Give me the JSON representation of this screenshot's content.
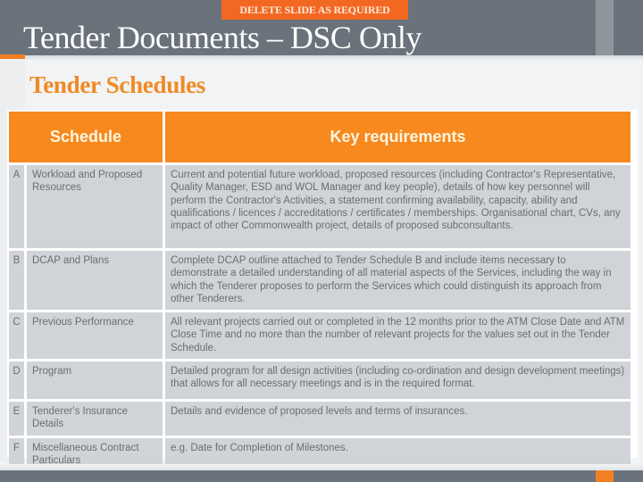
{
  "banner": {
    "label": "DELETE SLIDE AS REQUIRED"
  },
  "header": {
    "title": "Tender Documents – DSC Only"
  },
  "subtitle": "Tender Schedules",
  "colors": {
    "header_bg": "#6a737b",
    "accent_orange": "#f7891f",
    "banner_orange": "#f26722",
    "row_bg": "#d0d4d8",
    "subtitle": "#f08a24"
  },
  "table": {
    "headers": {
      "schedule": "Schedule",
      "requirements": "Key requirements"
    },
    "rows": [
      {
        "letter": "A",
        "schedule": "Workload and Proposed Resources",
        "requirements": "Current and potential future workload, proposed resources (including Contractor's Representative, Quality Manager, ESD and WOL Manager and key people), details of how key personnel will perform the Contractor's Activities, a statement confirming availability, capacity, ability and qualifications / licences / accreditations / certificates / memberships. Organisational chart, CVs, any impact of other Commonwealth project, details of proposed subconsultants."
      },
      {
        "letter": "B",
        "schedule": "DCAP and Plans",
        "requirements": "Complete DCAP outline attached to Tender Schedule B and include items necessary to demonstrate a detailed understanding of all material aspects of the Services, including the way in which the Tenderer proposes to perform the Services which could distinguish its approach from other Tenderers."
      },
      {
        "letter": "C",
        "schedule": "Previous Performance",
        "requirements": "All relevant projects carried out or completed in the 12 months prior to the ATM Close Date and ATM Close Time and no more than the number of relevant projects for the values set out in the Tender Schedule."
      },
      {
        "letter": "D",
        "schedule": "Program",
        "requirements": "Detailed program for all design activities (including co-ordination and design development meetings) that allows for all necessary meetings and is in the required format."
      },
      {
        "letter": "E",
        "schedule": "Tenderer's Insurance Details",
        "requirements": "Details and evidence of proposed levels and terms of insurances."
      },
      {
        "letter": "F",
        "schedule": "Miscellaneous Contract Particulars",
        "requirements": "e.g. Date for Completion of Milestones."
      }
    ]
  }
}
